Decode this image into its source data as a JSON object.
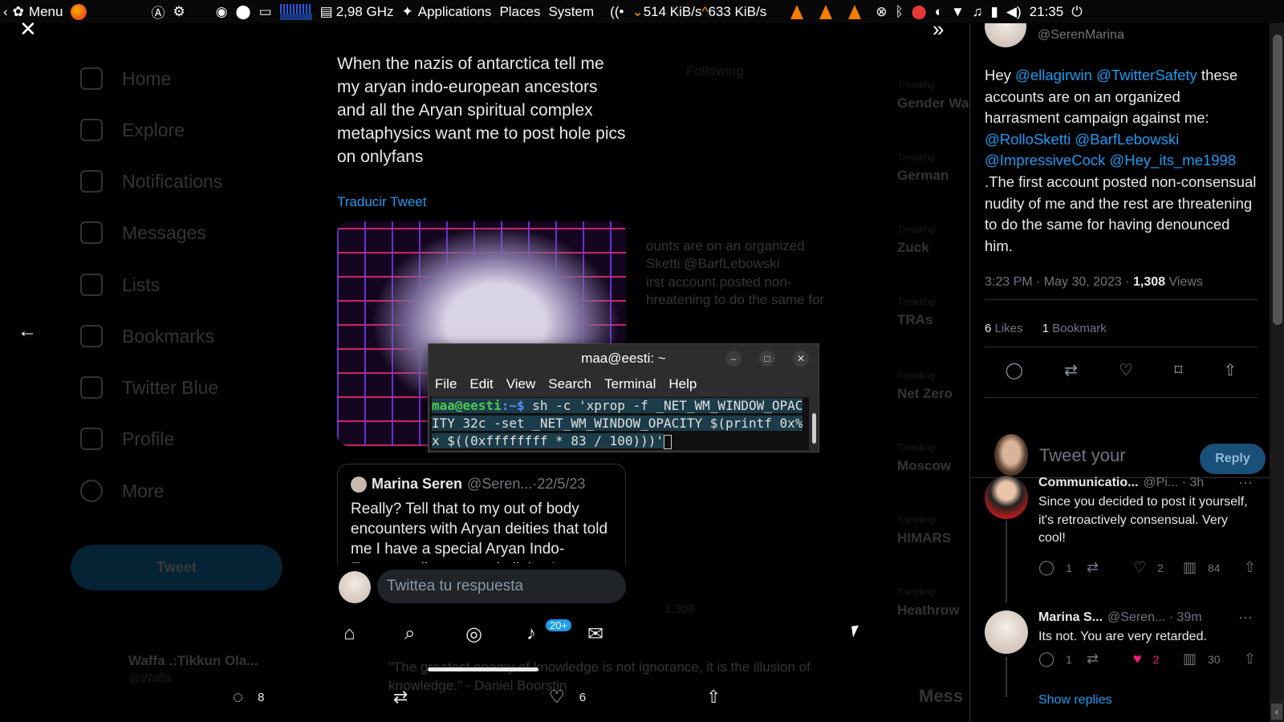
{
  "panel": {
    "menu_label": "Menu",
    "cpu_freq": "2,98 GHz",
    "applications": "Applications",
    "places": "Places",
    "system": "System",
    "net_down": "514 KiB/s",
    "net_up": "633 KiB/s",
    "clock": "21:35"
  },
  "background": {
    "nav": [
      "Home",
      "Explore",
      "Notifications",
      "Messages",
      "Lists",
      "Bookmarks",
      "Twitter Blue",
      "Profile",
      "More"
    ],
    "tweet_button": "Tweet",
    "account_name": "Waffa .:Tikkun Ola...",
    "account_handle": "@Waffa",
    "tab_following": "Following",
    "trends": [
      "Gender Wa",
      "German",
      "Zuck",
      "TRAs",
      "Net Zero",
      "Moscow",
      "HIMARS",
      "Heathrow"
    ],
    "middle_text": [
      "ounts are on an organized",
      "Sketti @BarfLebowski",
      "irst account posted non-",
      "hreatening to do the same for"
    ],
    "quote_line1": "\"The greatest enemy of knowledge is not ignorance, it is the illusion of",
    "quote_line2": "knowledge.\" - Daniel Boorstin",
    "views_count": "1,308",
    "messages_label": "Mess"
  },
  "viewer": {
    "tweet_text": "When the nazis of antarctica tell me my aryan indo-european ancestors and all the Aryan spiritual complex metaphysics want me to post hole pics on onlyfans",
    "translate": "Traducir Tweet",
    "quote": {
      "name": "Marina Seren",
      "handle_time": "@Seren...·22/5/23",
      "text": "Really? Tell that to my out of body encounters with Aryan deities that told me I have a special Aryan Indo-European lineage and all the Aryan"
    },
    "reply_placeholder": "Twittea tu respuesta",
    "notif_badge": "20+"
  },
  "bottom_actions": {
    "replies": "8",
    "likes": "6"
  },
  "terminal": {
    "title": "maa@eesti: ~",
    "menu": [
      "File",
      "Edit",
      "View",
      "Search",
      "Terminal",
      "Help"
    ],
    "prompt_host": "maa@eesti",
    "prompt_path": ":~$",
    "command": " sh -c 'xprop -f _NET_WM_WINDOW_OPACITY 32c -set _NET_WM_WINDOW_OPACITY $(printf 0x%x $((0xffffffff * 83 / 100)))'"
  },
  "right": {
    "handle": "@SerenMarina",
    "text_prefix": "Hey ",
    "mentions_1": "@ellagirwin @TwitterSafety",
    "text_mid": " these accounts are on an organized harrasment campaign against me: ",
    "mentions_2": "@RolloSketti @BarfLebowski @ImpressiveCock @Hey_its_me1998",
    "text_suffix": " .The first account posted non-consensual nudity of me and the rest are threatening to do the same for having denounced him.",
    "timestamp": "3:23 PM · May 30, 2023 · ",
    "views": "1,308",
    "views_label": " Views",
    "likes_count": "6",
    "likes_label": " Likes",
    "bookmarks_count": "1",
    "bookmarks_label": " Bookmark",
    "compose_placeholder": "Tweet your",
    "reply_button": "Reply",
    "replies": [
      {
        "name": "Communicatio...",
        "meta": "@Pi... · 3h",
        "text": "Since you decided to post it yourself, it's retroactively consensual. Very cool!",
        "reply_count": "1",
        "like_count": "2",
        "views": "84"
      },
      {
        "name": "Marina S...",
        "meta": "@Seren... · 39m",
        "text": "Its not. You are very retarded.",
        "reply_count": "1",
        "like_count": "2",
        "views": "30"
      }
    ],
    "show_replies": "Show replies"
  }
}
